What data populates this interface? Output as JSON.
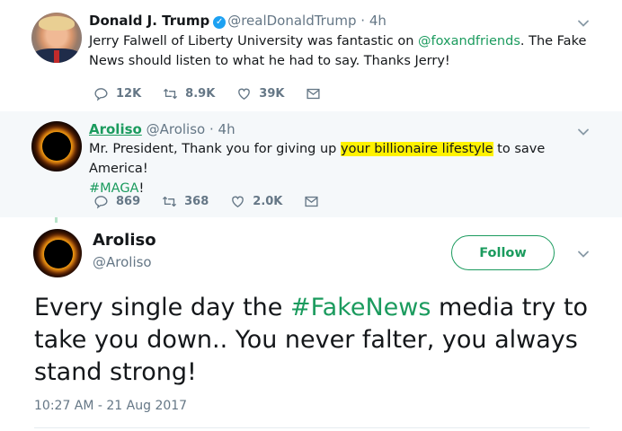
{
  "colors": {
    "accent": "#1b9b5e",
    "verified": "#1da1f2",
    "highlight": "#fff200",
    "muted": "#657786",
    "thread_line": "#b6e3c9"
  },
  "tweets": [
    {
      "name": "Donald J. Trump",
      "handle": "@realDonaldTrump",
      "time": "· 4h",
      "verified": true,
      "text_before": "Jerry Falwell of Liberty University was fantastic on ",
      "mention": "@foxandfriends",
      "text_after": ". The Fake News should listen to what he had to say. Thanks Jerry!",
      "replies": "12K",
      "retweets": "8.9K",
      "likes": "39K",
      "icons": [
        "reply-icon",
        "retweet-icon",
        "heart-icon",
        "mail-icon",
        "chevron-down-icon"
      ]
    },
    {
      "name": "Aroliso",
      "handle": "@Aroliso",
      "time": "· 4h",
      "text_before": "Mr. President, Thank you for giving up ",
      "highlight": "your billionaire lifestyle",
      "text_after": " to save America!",
      "hashtag": "#MAGA",
      "text_end": "!",
      "replies": "869",
      "retweets": "368",
      "likes": "2.0K"
    }
  ],
  "focused": {
    "name": "Aroliso",
    "handle": "@Aroliso",
    "follow_label": "Follow",
    "text_before": "Every single day the ",
    "hashtag": "#FakeNews",
    "text_after": " media try to take you down.. You never falter, you always stand strong!",
    "timestamp": "10:27 AM - 21 Aug 2017"
  }
}
